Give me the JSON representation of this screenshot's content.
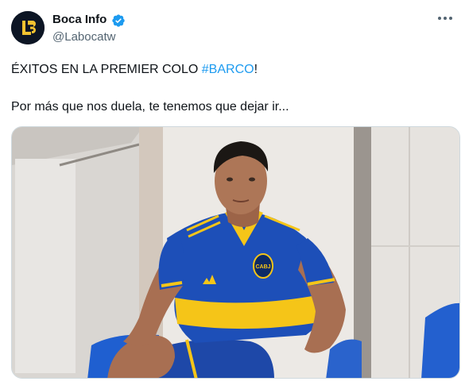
{
  "author": {
    "display_name": "Boca Info",
    "handle": "@Labocatw",
    "avatar_initials": "LB",
    "verified_icon": "verified-badge-icon"
  },
  "tweet": {
    "text_line1_prefix": "ÉXITOS EN LA PREMIER COLO ",
    "hashtag": "#BARCO",
    "text_line1_suffix": "!",
    "text_line2": "Por más que nos duela, te tenemos que dejar ir..."
  },
  "media": {
    "kind": "photo",
    "jersey_badge": "CABJ"
  },
  "colors": {
    "link": "#1d9bf0",
    "verified": "#1d9bf0",
    "text": "#0f1419",
    "secondary_text": "#536471",
    "avatar_bg": "#0c1524",
    "avatar_logo": "#f2c230",
    "jersey_blue": "#1d4fb8",
    "jersey_yellow": "#f5c518"
  },
  "icons": {
    "more": "more-dots-icon"
  }
}
